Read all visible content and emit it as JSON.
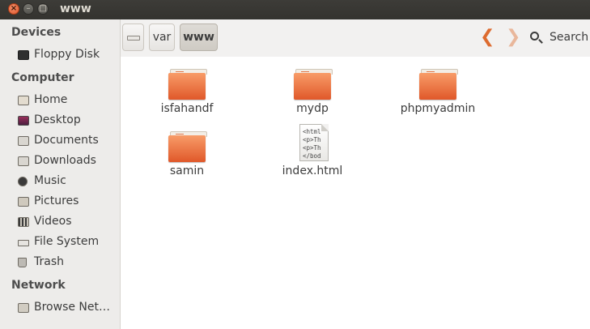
{
  "window": {
    "title": "www",
    "controls": {
      "close": "×",
      "minimize": "–",
      "maximize": "□"
    }
  },
  "sidebar": {
    "sections": [
      {
        "heading": "Devices",
        "items": [
          {
            "label": "Floppy Disk",
            "icon": "floppy-disk-icon"
          }
        ]
      },
      {
        "heading": "Computer",
        "items": [
          {
            "label": "Home",
            "icon": "home-folder-icon"
          },
          {
            "label": "Desktop",
            "icon": "desktop-icon"
          },
          {
            "label": "Documents",
            "icon": "documents-folder-icon"
          },
          {
            "label": "Downloads",
            "icon": "downloads-folder-icon"
          },
          {
            "label": "Music",
            "icon": "music-folder-icon"
          },
          {
            "label": "Pictures",
            "icon": "pictures-folder-icon"
          },
          {
            "label": "Videos",
            "icon": "videos-folder-icon"
          },
          {
            "label": "File System",
            "icon": "drive-icon"
          },
          {
            "label": "Trash",
            "icon": "trash-icon"
          }
        ]
      },
      {
        "heading": "Network",
        "items": [
          {
            "label": "Browse Net…",
            "icon": "network-icon"
          }
        ]
      }
    ]
  },
  "toolbar": {
    "breadcrumbs": [
      {
        "label": "",
        "icon": "drive-icon"
      },
      {
        "label": "var"
      },
      {
        "label": "www",
        "active": true
      }
    ],
    "back_glyph": "❮",
    "forward_glyph": "❯",
    "search_label": "Search"
  },
  "files": [
    {
      "name": "isfahandf",
      "type": "folder"
    },
    {
      "name": "mydp",
      "type": "folder"
    },
    {
      "name": "phpmyadmin",
      "type": "folder"
    },
    {
      "name": "samin",
      "type": "folder"
    },
    {
      "name": "index.html",
      "type": "html",
      "preview": "<html\n<p>Th\n<p>Th\n</bod"
    }
  ],
  "colors": {
    "accent": "#dd6b2f",
    "folder": "#f0743e",
    "titlebar": "#3c3b37",
    "sidebar_bg": "#edecea",
    "content_bg": "#ffffff"
  }
}
